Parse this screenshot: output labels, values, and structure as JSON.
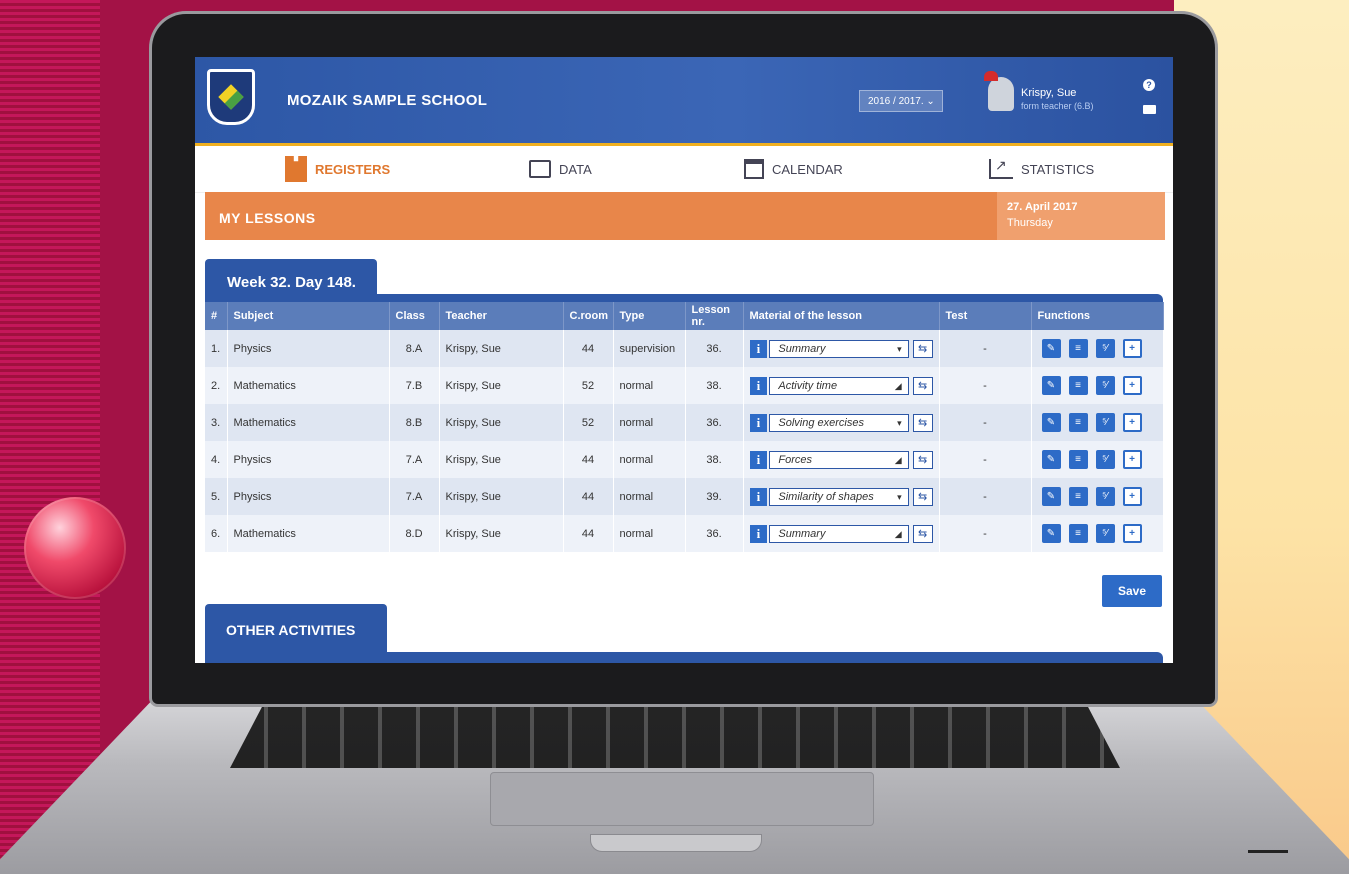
{
  "header": {
    "school_name": "MOZAIK SAMPLE SCHOOL",
    "year": "2016 / 2017.",
    "user_name": "Krispy, Sue",
    "user_role": "form teacher (6.B)"
  },
  "nav": [
    {
      "label": "REGISTERS",
      "active": true,
      "icon": "registers-icon"
    },
    {
      "label": "DATA",
      "active": false,
      "icon": "data-icon"
    },
    {
      "label": "CALENDAR",
      "active": false,
      "icon": "calendar-icon"
    },
    {
      "label": "STATISTICS",
      "active": false,
      "icon": "statistics-icon"
    }
  ],
  "lessons": {
    "title": "MY LESSONS",
    "date": "27. April 2017",
    "weekday": "Thursday",
    "week_tab": "Week 32. Day 148."
  },
  "table": {
    "columns": [
      "#",
      "Subject",
      "Class",
      "Teacher",
      "C.room",
      "Type",
      "Lesson nr.",
      "Material of the lesson",
      "Test",
      "Functions"
    ],
    "rows": [
      {
        "num": "1.",
        "subject": "Physics",
        "class": "8.A",
        "teacher": "Krispy, Sue",
        "room": "44",
        "type": "supervision",
        "lesson": "36.",
        "material": "Summary",
        "dropdown": true,
        "test": "-"
      },
      {
        "num": "2.",
        "subject": "Mathematics",
        "class": "7.B",
        "teacher": "Krispy, Sue",
        "room": "52",
        "type": "normal",
        "lesson": "38.",
        "material": "Activity time",
        "dropdown": false,
        "test": "-"
      },
      {
        "num": "3.",
        "subject": "Mathematics",
        "class": "8.B",
        "teacher": "Krispy, Sue",
        "room": "52",
        "type": "normal",
        "lesson": "36.",
        "material": "Solving exercises",
        "dropdown": true,
        "test": "-"
      },
      {
        "num": "4.",
        "subject": "Physics",
        "class": "7.A",
        "teacher": "Krispy, Sue",
        "room": "44",
        "type": "normal",
        "lesson": "38.",
        "material": "Forces",
        "dropdown": false,
        "test": "-"
      },
      {
        "num": "5.",
        "subject": "Physics",
        "class": "7.A",
        "teacher": "Krispy, Sue",
        "room": "44",
        "type": "normal",
        "lesson": "39.",
        "material": "Similarity of shapes",
        "dropdown": true,
        "test": "-"
      },
      {
        "num": "6.",
        "subject": "Mathematics",
        "class": "8.D",
        "teacher": "Krispy, Sue",
        "room": "44",
        "type": "normal",
        "lesson": "36.",
        "material": "Summary",
        "dropdown": false,
        "test": "-"
      }
    ]
  },
  "buttons": {
    "save": "Save",
    "other_activities": "OTHER ACTIVITIES"
  },
  "colors": {
    "header_blue": "#2d57a6",
    "accent_orange": "#e8864a",
    "button_blue": "#2d6bc7"
  }
}
